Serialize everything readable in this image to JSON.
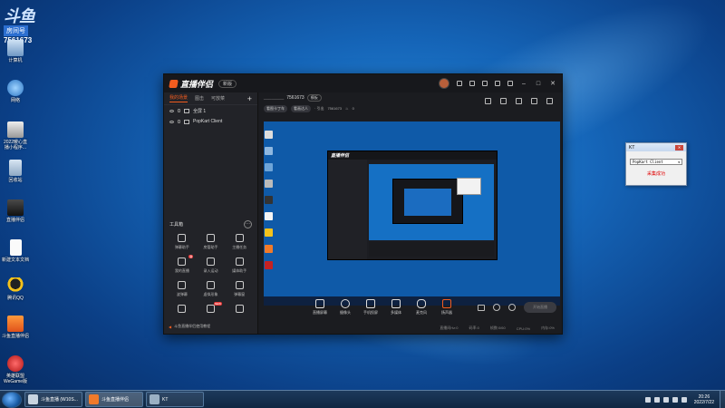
{
  "colors": {
    "accent": "#f25c1f",
    "desktop": "#1565b8",
    "app_bg": "#1e1f24",
    "error_red": "#e00000"
  },
  "sticker": {
    "logo": "斗鱼",
    "room_label": "房间号",
    "room_number": "7561673"
  },
  "desktop_icons": [
    {
      "label": "Administr...",
      "icon": "user-folder-icon"
    },
    {
      "label": "计算机",
      "icon": "computer-icon"
    },
    {
      "label": "网络",
      "icon": "network-icon"
    },
    {
      "label": "2022暖心直播小程序...",
      "icon": "app-icon"
    },
    {
      "label": "回收站",
      "icon": "recycle-bin-icon"
    },
    {
      "label": "直播伴侣",
      "icon": "app-icon"
    },
    {
      "label": "新建文本文档",
      "icon": "document-icon"
    },
    {
      "label": "腾讯QQ",
      "icon": "qq-icon"
    },
    {
      "label": "斗鱼直播伴侣",
      "icon": "app-icon"
    },
    {
      "label": "英雄联盟WeGame版",
      "icon": "game-icon"
    }
  ],
  "app": {
    "brand": "直播伴侣",
    "version_label": "新版",
    "sidebar": {
      "tabs": [
        "我的场景",
        "图击",
        "可放菜"
      ],
      "add": "+",
      "scenes": [
        {
          "label": "全屏 1"
        },
        {
          "label": "PopKart Client"
        }
      ],
      "tools_title": "工具箱",
      "tools_more": "···",
      "tools": [
        {
          "label": "弹幕助手",
          "badge": ""
        },
        {
          "label": "房管助手",
          "badge": ""
        },
        {
          "label": "主播任务",
          "badge": ""
        },
        {
          "label": "我的直播",
          "badge": "新"
        },
        {
          "label": "录入运动",
          "badge": ""
        },
        {
          "label": "媒体助手",
          "badge": ""
        },
        {
          "label": "波弹幕",
          "badge": ""
        },
        {
          "label": "虚拟形象",
          "badge": ""
        },
        {
          "label": "弹幕窗",
          "badge": ""
        },
        {
          "label": "",
          "badge": "NEW"
        },
        {
          "label": "",
          "badge": "NEW"
        },
        {
          "label": "",
          "badge": ""
        }
      ],
      "footer": "斗鱼直播伴侣使用教程"
    },
    "main": {
      "room_number": "7561673",
      "room_pill": "模板",
      "tags": [
        "看图卡丁车",
        "看画达人"
      ],
      "online_label": "· 引出",
      "online_value": "7561673",
      "fans_value": "0",
      "bottom_items": [
        {
          "label": "直播屏幕",
          "icon": "screen-icon"
        },
        {
          "label": "摄像头",
          "icon": "camera-icon"
        },
        {
          "label": "手机投屏",
          "icon": "phone-cast-icon"
        },
        {
          "label": "多媒体",
          "icon": "media-icon"
        },
        {
          "label": "麦克风",
          "icon": "mic-icon"
        },
        {
          "label": "扬声器",
          "icon": "speaker-icon"
        }
      ],
      "go_live_label": "开始直播",
      "status": [
        "直播间Hz:0",
        "码率:0",
        "帧数:0/60",
        "CPU:0%",
        "内存:0%"
      ]
    }
  },
  "kt_dialog": {
    "title": "KT",
    "select_value": "PopKart Client",
    "status": "采集成功"
  },
  "taskbar": {
    "tasks": [
      {
        "label": "斗鱼直播 (W10S...",
        "active": false
      },
      {
        "label": "斗鱼直播伴侣",
        "active": true
      },
      {
        "label": "KT",
        "active": false
      }
    ],
    "time": "20:26",
    "date": "2022/7/22"
  }
}
